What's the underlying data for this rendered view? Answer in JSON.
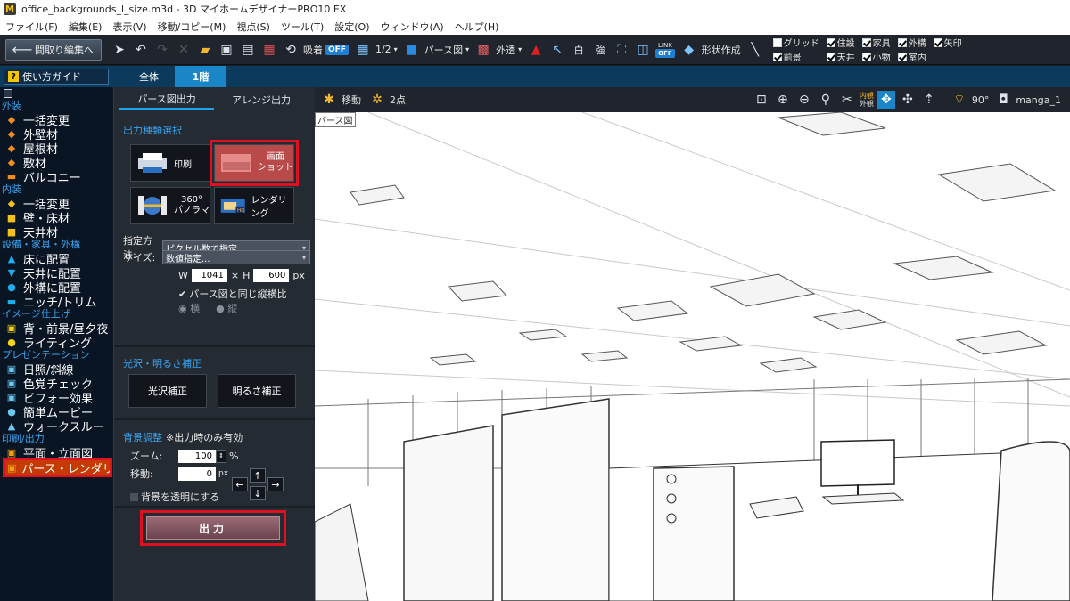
{
  "title": "office_backgrounds_l_size.m3d - 3D マイホームデザイナーPRO10 EX",
  "menu": [
    "ファイル(F)",
    "編集(E)",
    "表示(V)",
    "移動/コピー(M)",
    "視点(S)",
    "ツール(T)",
    "設定(O)",
    "ウィンドウ(A)",
    "ヘルプ(H)"
  ],
  "toolbar": {
    "back_label": "間取り編集へ",
    "suction_label": "吸着",
    "suction_state": "OFF",
    "ratio_label": "1/2",
    "view_label": "パース図",
    "transparency_label": "外透",
    "link_label": "LINK",
    "link_state": "OFF",
    "shape_label": "形状作成",
    "checks": [
      {
        "label": "グリッド",
        "on": false
      },
      {
        "label": "住設",
        "on": true
      },
      {
        "label": "家具",
        "on": true
      },
      {
        "label": "外構",
        "on": true
      },
      {
        "label": "矢印",
        "on": true
      },
      {
        "label": "前景",
        "on": true
      },
      {
        "label": "天井",
        "on": true
      },
      {
        "label": "小物",
        "on": true
      },
      {
        "label": "室内",
        "on": true
      }
    ]
  },
  "tabs": {
    "guide_label": "使い方ガイド",
    "all_label": "全体",
    "floor_label": "1階"
  },
  "sidebar": {
    "sections": [
      {
        "title": "外装",
        "items": [
          "一括変更",
          "外壁材",
          "屋根材",
          "敷材",
          "バルコニー"
        ]
      },
      {
        "title": "内装",
        "items": [
          "一括変更",
          "壁・床材",
          "天井材"
        ]
      },
      {
        "title": "設備・家具・外構",
        "items": [
          "床に配置",
          "天井に配置",
          "外構に配置",
          "ニッチ/トリム"
        ]
      },
      {
        "title": "イメージ仕上げ",
        "items": [
          "背・前景/昼夕夜",
          "ライティング"
        ]
      },
      {
        "title": "プレゼンテーション",
        "items": [
          "日照/斜線",
          "色覚チェック",
          "ビフォー効果",
          "簡単ムービー",
          "ウォークスルー"
        ]
      },
      {
        "title": "印刷/出力",
        "items": [
          "平面・立面図",
          "パース・レンダリング"
        ]
      }
    ]
  },
  "panel": {
    "tab_perspective": "パース図出力",
    "tab_arrange": "アレンジ出力",
    "output_type_label": "出力種類選択",
    "btn_print": "印刷",
    "btn_screenshot_line1": "画面",
    "btn_screenshot_line2": "ショット",
    "btn_panorama_line1": "360°",
    "btn_panorama_line2": "パノラマ",
    "btn_rendering": "レンダリング",
    "method_label": "指定方法:",
    "method_value": "ピクセル数で指定",
    "size_label": "サイズ:",
    "size_value": "数値指定...",
    "w_label": "W",
    "w_value": "1041",
    "x_sep": "×",
    "h_label": "H",
    "h_value": "600",
    "px_unit": "px",
    "same_ratio_label": "パース図と同じ縦横比",
    "radio_landscape": "横",
    "radio_portrait": "縦",
    "gloss_label": "光沢・明るさ補正",
    "gloss_btn": "光沢補正",
    "bright_btn": "明るさ補正",
    "bg_label": "背景調整",
    "bg_note": "※出力時のみ有効",
    "zoom_label": "ズーム:",
    "zoom_value": "100",
    "pct_unit": "%",
    "move_label": "移動:",
    "move_value": "0",
    "transparent_label": "背景を透明にする",
    "output_btn": "出力"
  },
  "viewbar": {
    "move_label": "移動",
    "twopoint_label": "2点",
    "inside_label": "内観",
    "outside_label": "外観",
    "angle_label": "90°",
    "camera_label": "manga_1"
  },
  "viewport": {
    "label": "パース図"
  }
}
